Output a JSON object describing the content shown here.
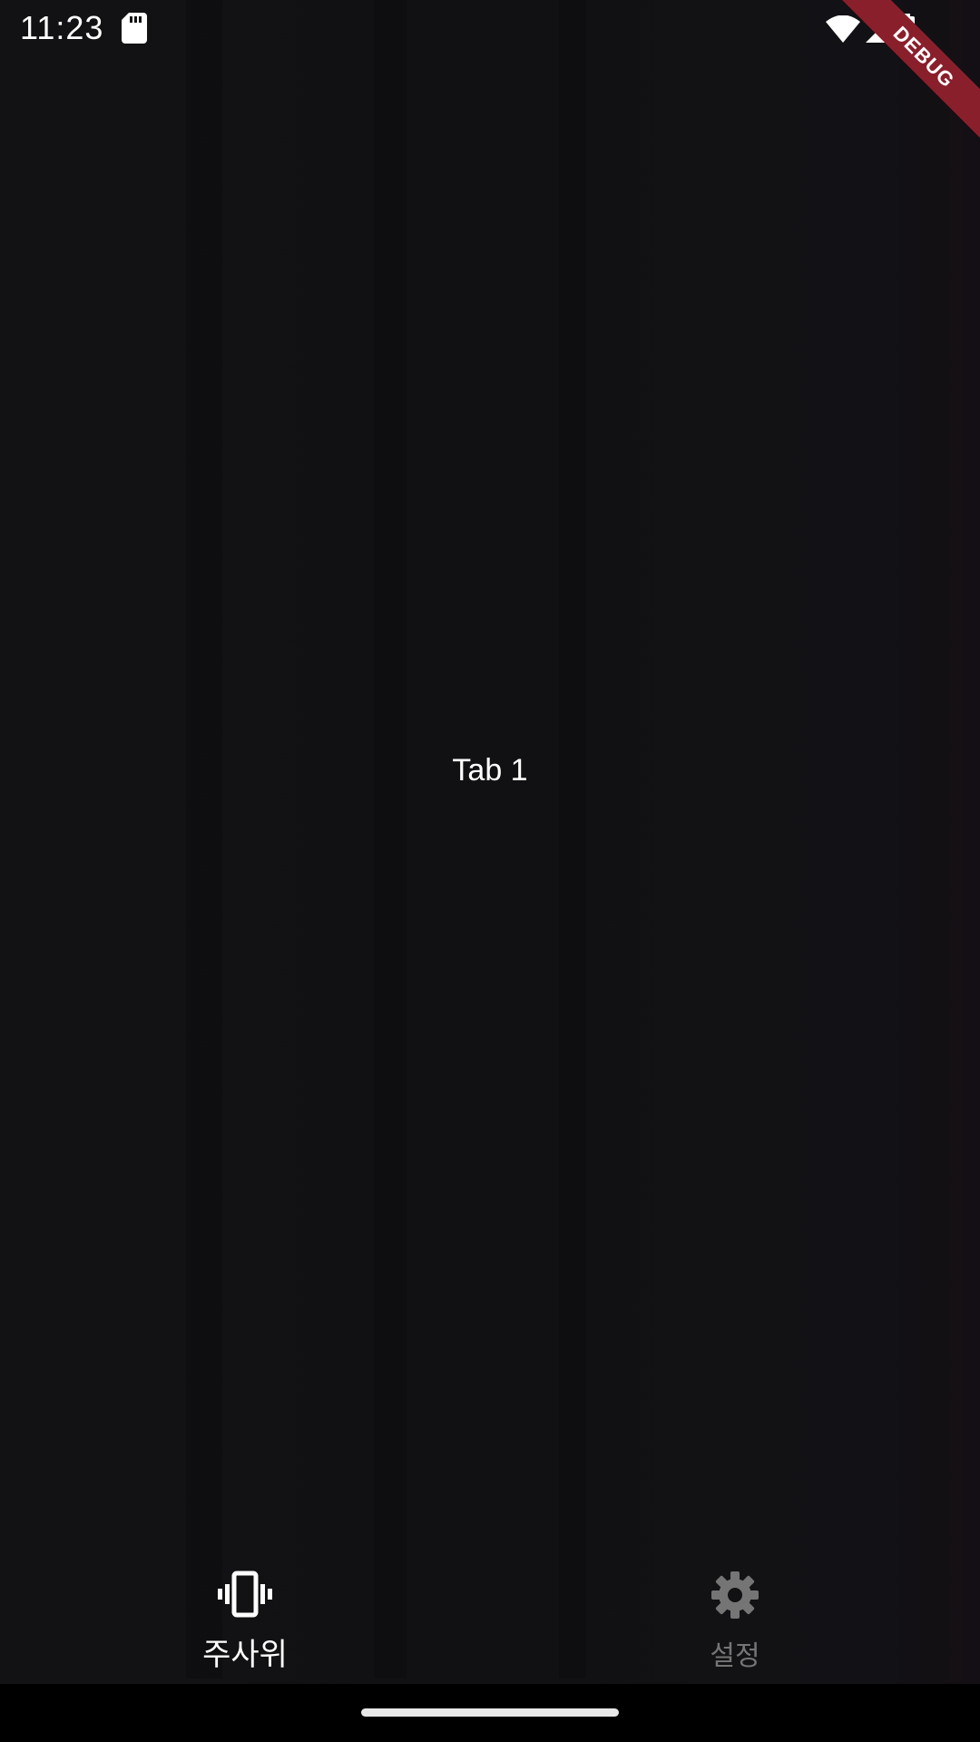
{
  "status_bar": {
    "time": "11:23",
    "icons": [
      "sd-card-icon",
      "wifi-icon",
      "cellular-signal-icon",
      "battery-icon"
    ]
  },
  "debug_banner": {
    "label": "DEBUG"
  },
  "main": {
    "content_text": "Tab 1"
  },
  "bottom_nav": {
    "items": [
      {
        "label": "주사위",
        "icon": "vibration-phone-icon",
        "active": true
      },
      {
        "label": "설정",
        "icon": "gear-icon",
        "active": false
      }
    ]
  },
  "colors": {
    "background": "#111113",
    "active": "#ffffff",
    "inactive": "#757575",
    "debug_ribbon": "#8a1f2c"
  }
}
